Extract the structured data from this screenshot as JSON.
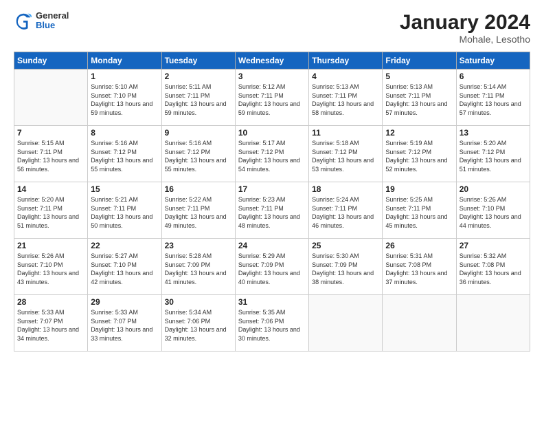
{
  "header": {
    "logo": {
      "general": "General",
      "blue": "Blue"
    },
    "title": "January 2024",
    "location": "Mohale, Lesotho"
  },
  "columns": [
    "Sunday",
    "Monday",
    "Tuesday",
    "Wednesday",
    "Thursday",
    "Friday",
    "Saturday"
  ],
  "weeks": [
    [
      {
        "day": "",
        "sunrise": "",
        "sunset": "",
        "daylight": ""
      },
      {
        "day": "1",
        "sunrise": "5:10 AM",
        "sunset": "7:10 PM",
        "daylight": "13 hours and 59 minutes."
      },
      {
        "day": "2",
        "sunrise": "5:11 AM",
        "sunset": "7:11 PM",
        "daylight": "13 hours and 59 minutes."
      },
      {
        "day": "3",
        "sunrise": "5:12 AM",
        "sunset": "7:11 PM",
        "daylight": "13 hours and 59 minutes."
      },
      {
        "day": "4",
        "sunrise": "5:13 AM",
        "sunset": "7:11 PM",
        "daylight": "13 hours and 58 minutes."
      },
      {
        "day": "5",
        "sunrise": "5:13 AM",
        "sunset": "7:11 PM",
        "daylight": "13 hours and 57 minutes."
      },
      {
        "day": "6",
        "sunrise": "5:14 AM",
        "sunset": "7:11 PM",
        "daylight": "13 hours and 57 minutes."
      }
    ],
    [
      {
        "day": "7",
        "sunrise": "5:15 AM",
        "sunset": "7:11 PM",
        "daylight": "13 hours and 56 minutes."
      },
      {
        "day": "8",
        "sunrise": "5:16 AM",
        "sunset": "7:12 PM",
        "daylight": "13 hours and 55 minutes."
      },
      {
        "day": "9",
        "sunrise": "5:16 AM",
        "sunset": "7:12 PM",
        "daylight": "13 hours and 55 minutes."
      },
      {
        "day": "10",
        "sunrise": "5:17 AM",
        "sunset": "7:12 PM",
        "daylight": "13 hours and 54 minutes."
      },
      {
        "day": "11",
        "sunrise": "5:18 AM",
        "sunset": "7:12 PM",
        "daylight": "13 hours and 53 minutes."
      },
      {
        "day": "12",
        "sunrise": "5:19 AM",
        "sunset": "7:12 PM",
        "daylight": "13 hours and 52 minutes."
      },
      {
        "day": "13",
        "sunrise": "5:20 AM",
        "sunset": "7:12 PM",
        "daylight": "13 hours and 51 minutes."
      }
    ],
    [
      {
        "day": "14",
        "sunrise": "5:20 AM",
        "sunset": "7:11 PM",
        "daylight": "13 hours and 51 minutes."
      },
      {
        "day": "15",
        "sunrise": "5:21 AM",
        "sunset": "7:11 PM",
        "daylight": "13 hours and 50 minutes."
      },
      {
        "day": "16",
        "sunrise": "5:22 AM",
        "sunset": "7:11 PM",
        "daylight": "13 hours and 49 minutes."
      },
      {
        "day": "17",
        "sunrise": "5:23 AM",
        "sunset": "7:11 PM",
        "daylight": "13 hours and 48 minutes."
      },
      {
        "day": "18",
        "sunrise": "5:24 AM",
        "sunset": "7:11 PM",
        "daylight": "13 hours and 46 minutes."
      },
      {
        "day": "19",
        "sunrise": "5:25 AM",
        "sunset": "7:11 PM",
        "daylight": "13 hours and 45 minutes."
      },
      {
        "day": "20",
        "sunrise": "5:26 AM",
        "sunset": "7:10 PM",
        "daylight": "13 hours and 44 minutes."
      }
    ],
    [
      {
        "day": "21",
        "sunrise": "5:26 AM",
        "sunset": "7:10 PM",
        "daylight": "13 hours and 43 minutes."
      },
      {
        "day": "22",
        "sunrise": "5:27 AM",
        "sunset": "7:10 PM",
        "daylight": "13 hours and 42 minutes."
      },
      {
        "day": "23",
        "sunrise": "5:28 AM",
        "sunset": "7:09 PM",
        "daylight": "13 hours and 41 minutes."
      },
      {
        "day": "24",
        "sunrise": "5:29 AM",
        "sunset": "7:09 PM",
        "daylight": "13 hours and 40 minutes."
      },
      {
        "day": "25",
        "sunrise": "5:30 AM",
        "sunset": "7:09 PM",
        "daylight": "13 hours and 38 minutes."
      },
      {
        "day": "26",
        "sunrise": "5:31 AM",
        "sunset": "7:08 PM",
        "daylight": "13 hours and 37 minutes."
      },
      {
        "day": "27",
        "sunrise": "5:32 AM",
        "sunset": "7:08 PM",
        "daylight": "13 hours and 36 minutes."
      }
    ],
    [
      {
        "day": "28",
        "sunrise": "5:33 AM",
        "sunset": "7:07 PM",
        "daylight": "13 hours and 34 minutes."
      },
      {
        "day": "29",
        "sunrise": "5:33 AM",
        "sunset": "7:07 PM",
        "daylight": "13 hours and 33 minutes."
      },
      {
        "day": "30",
        "sunrise": "5:34 AM",
        "sunset": "7:06 PM",
        "daylight": "13 hours and 32 minutes."
      },
      {
        "day": "31",
        "sunrise": "5:35 AM",
        "sunset": "7:06 PM",
        "daylight": "13 hours and 30 minutes."
      },
      {
        "day": "",
        "sunrise": "",
        "sunset": "",
        "daylight": ""
      },
      {
        "day": "",
        "sunrise": "",
        "sunset": "",
        "daylight": ""
      },
      {
        "day": "",
        "sunrise": "",
        "sunset": "",
        "daylight": ""
      }
    ]
  ]
}
